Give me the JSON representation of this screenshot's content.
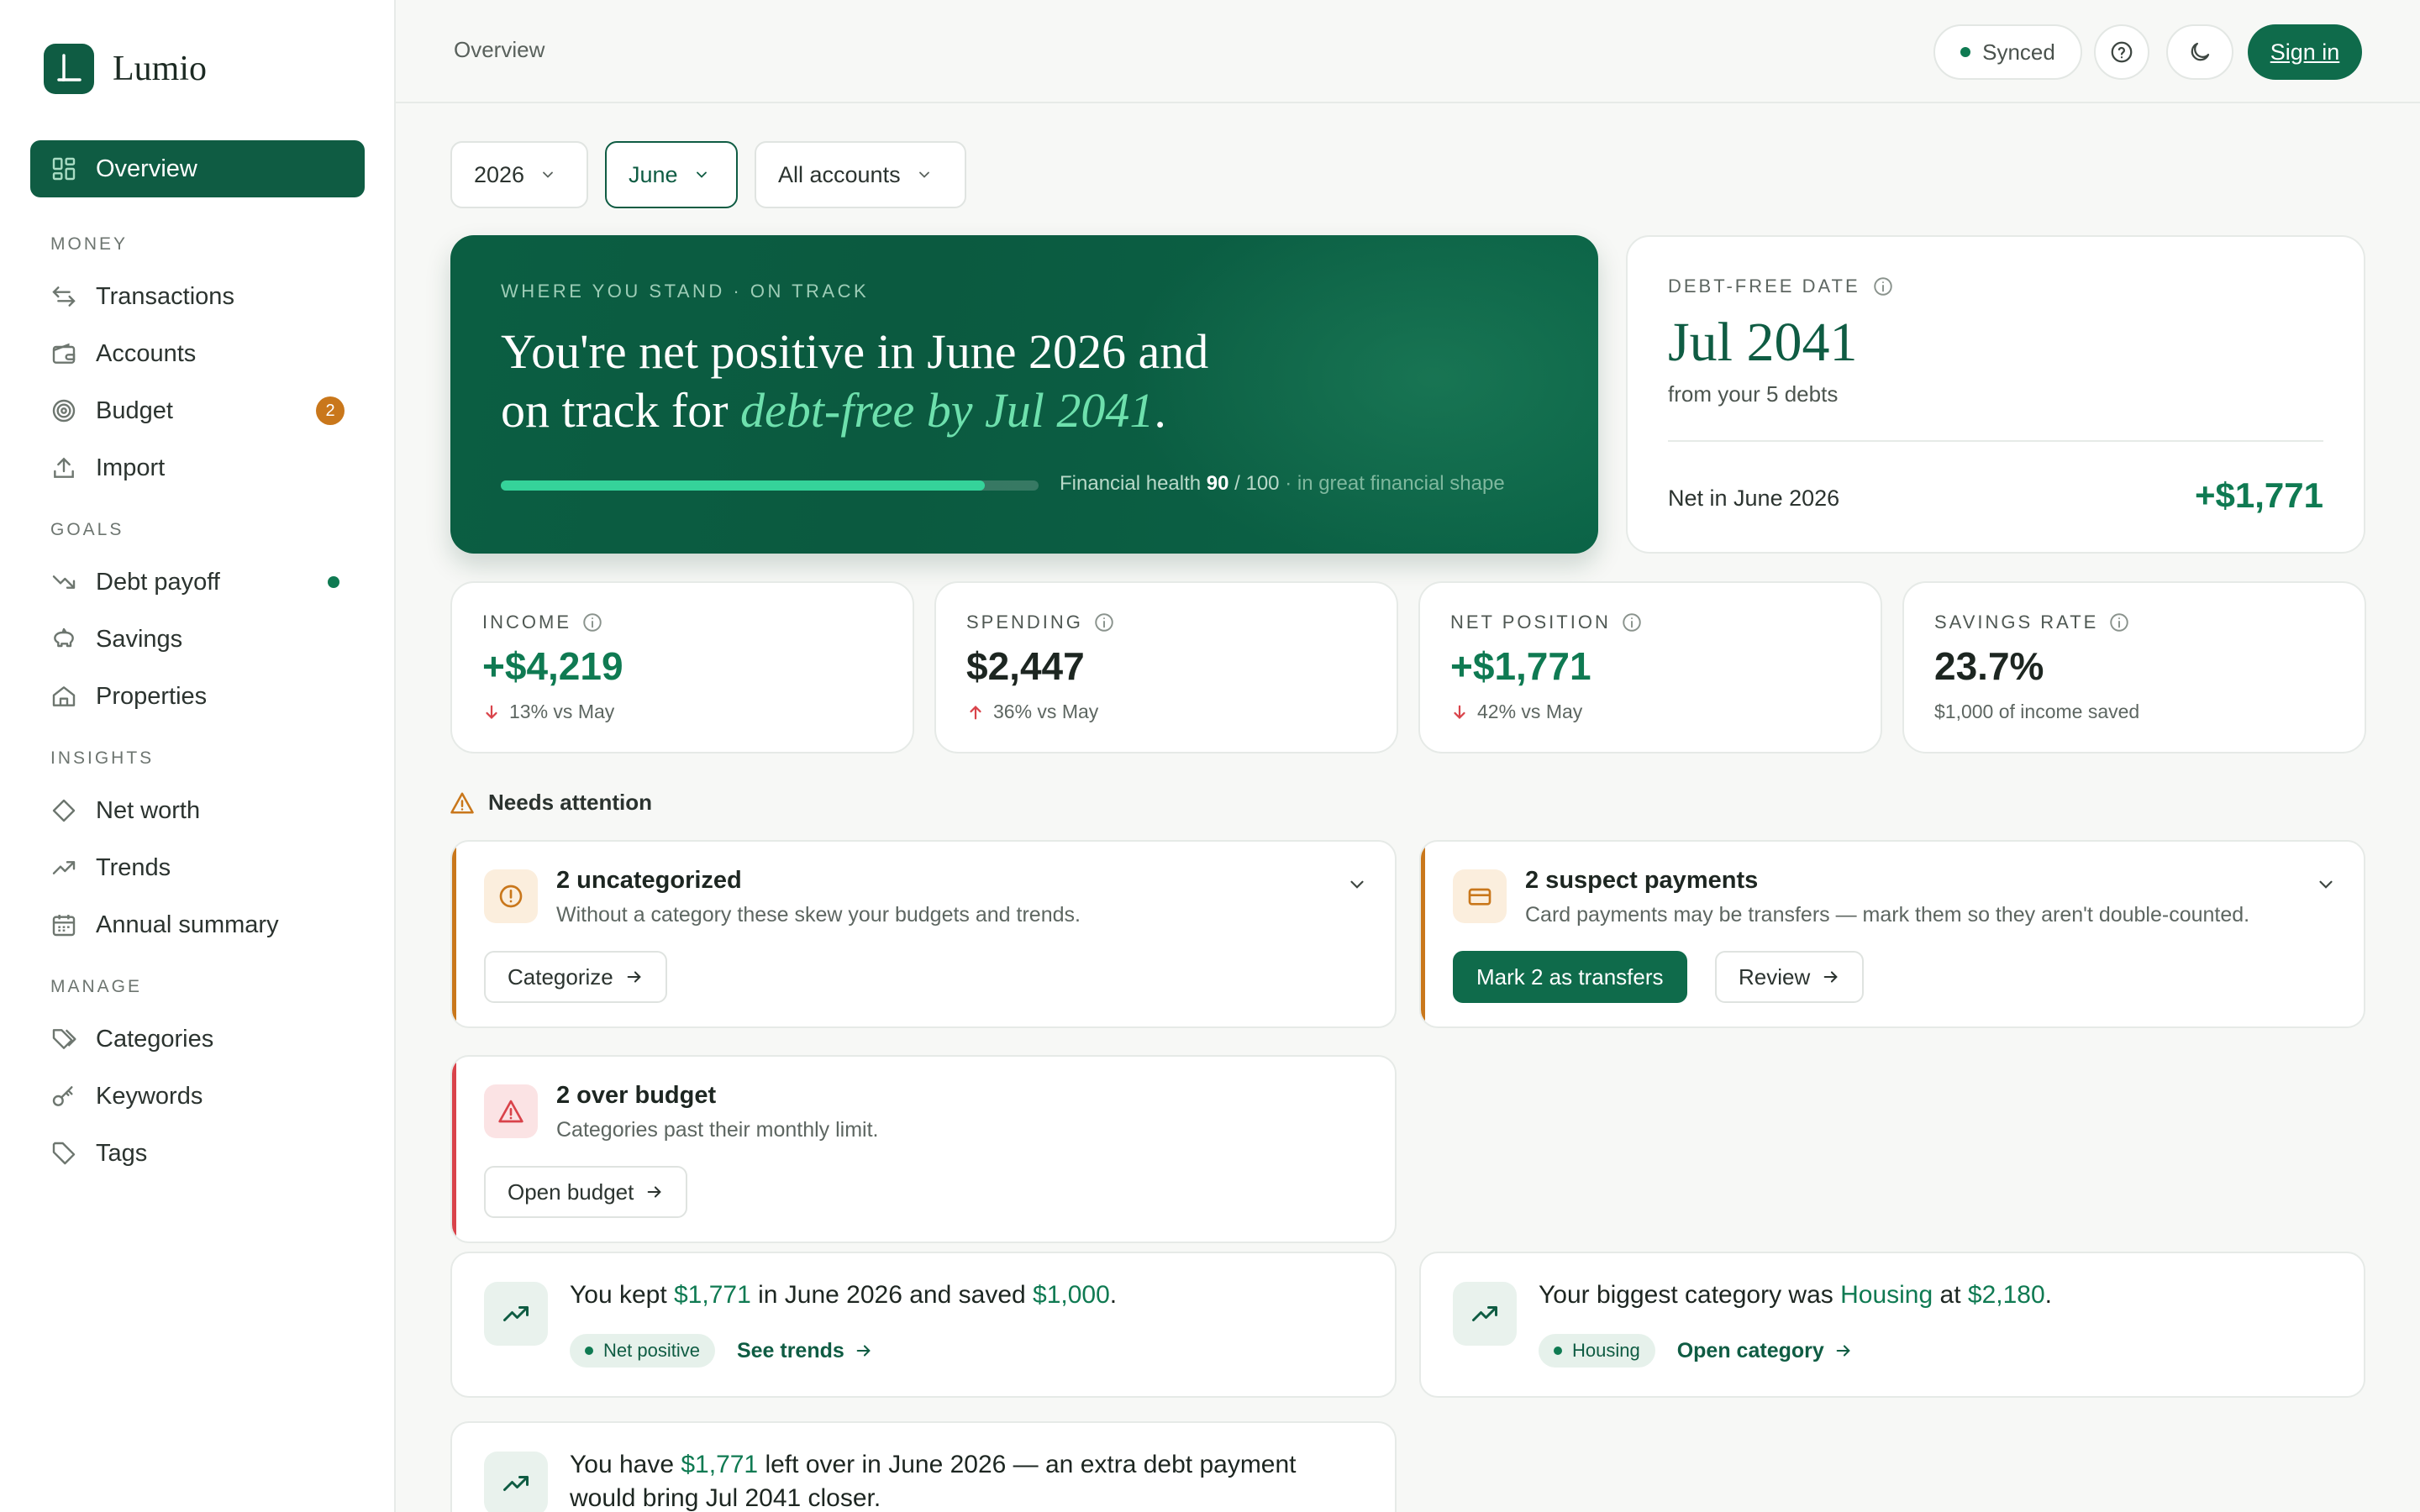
{
  "app": {
    "name": "Lumio"
  },
  "sidebar": {
    "overview": "Overview",
    "sections": {
      "money": "MONEY",
      "goals": "GOALS",
      "insights": "INSIGHTS",
      "manage": "MANAGE"
    },
    "items": {
      "transactions": "Transactions",
      "accounts": "Accounts",
      "budget": "Budget",
      "budget_badge": "2",
      "import": "Import",
      "debt_payoff": "Debt payoff",
      "savings": "Savings",
      "properties": "Properties",
      "net_worth": "Net worth",
      "trends": "Trends",
      "annual_summary": "Annual summary",
      "categories": "Categories",
      "keywords": "Keywords",
      "tags": "Tags"
    }
  },
  "header": {
    "breadcrumb": "Overview",
    "sync_status": "Synced",
    "sign_in": "Sign in"
  },
  "filters": {
    "year": "2026",
    "month": "June",
    "accounts": "All accounts"
  },
  "hero": {
    "kicker": "WHERE YOU STAND · ON TRACK",
    "title_part1": "You're net positive in June 2026 and",
    "title_part2": "on track for ",
    "title_accent": "debt-free by Jul 2041",
    "title_end": ".",
    "health_label": "Financial health ",
    "health_score": "90",
    "health_max": " / 100",
    "health_note": " · in great financial shape",
    "health_fraction": 0.9
  },
  "debt_card": {
    "label": "DEBT-FREE DATE",
    "date": "Jul 2041",
    "subtitle": "from your 5 debts",
    "net_label": "Net in June 2026",
    "net_value": "+$1,771"
  },
  "stats": {
    "income": {
      "label": "INCOME",
      "value": "+$4,219",
      "note": "13% vs May"
    },
    "spending": {
      "label": "SPENDING",
      "value": "$2,447",
      "note": "36% vs May"
    },
    "net": {
      "label": "NET POSITION",
      "value": "+$1,771",
      "note": "42% vs May"
    },
    "savings": {
      "label": "SAVINGS RATE",
      "value": "23.7%",
      "note": "$1,000 of income saved"
    }
  },
  "attention": {
    "heading": "Needs attention",
    "uncategorized": {
      "title": "2 uncategorized",
      "desc": "Without a category these skew your budgets and trends.",
      "action": "Categorize"
    },
    "suspect": {
      "title": "2 suspect payments",
      "desc": "Card payments may be transfers — mark them so they aren't double-counted.",
      "primary": "Mark 2 as transfers",
      "secondary": "Review"
    },
    "over_budget": {
      "title": "2 over budget",
      "desc": "Categories past their monthly limit.",
      "action": "Open budget"
    }
  },
  "insights": {
    "kept": {
      "t1": "You kept ",
      "v1": "$1,771",
      "t2": " in June 2026 and saved ",
      "v2": "$1,000",
      "t3": ".",
      "pill": "Net positive",
      "link": "See trends"
    },
    "biggest": {
      "t1": "Your biggest category was ",
      "v1": "Housing",
      "t2": " at ",
      "v2": "$2,180",
      "t3": ".",
      "pill": "Housing",
      "link": "Open category"
    },
    "leftover": {
      "t1": "You have ",
      "v1": "$1,771",
      "t2": " left over in June 2026 — an extra debt payment",
      "t3": "would bring Jul 2041 closer."
    }
  },
  "colors": {
    "brand": "#0f5c43",
    "positive": "#0f7a52",
    "warning": "#c9771b",
    "danger": "#d9434a",
    "hero_accent": "#6ee0ad"
  }
}
